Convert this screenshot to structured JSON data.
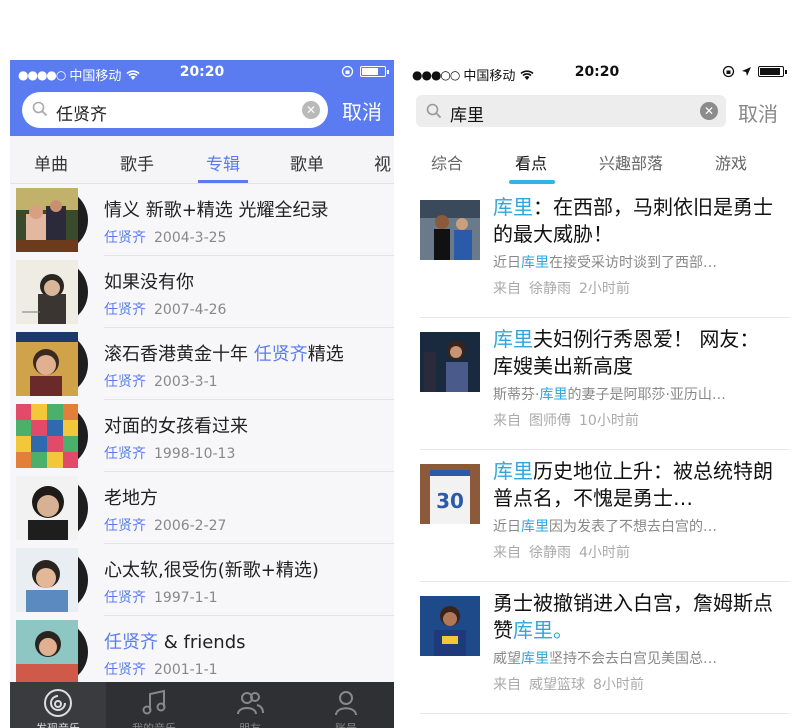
{
  "left": {
    "status": {
      "carrier": "中国移动",
      "time": "20:20"
    },
    "search": {
      "query": "任贤齐",
      "cancel": "取消"
    },
    "tabs": [
      "单曲",
      "歌手",
      "专辑",
      "歌单",
      "视"
    ],
    "active_tab": 2,
    "albums": [
      {
        "title": "情义 新歌+精选 光耀全纪录",
        "title_hl": "",
        "title_after": "",
        "artist": "任贤齐",
        "date": "2004-3-25"
      },
      {
        "title": "如果没有你",
        "title_hl": "",
        "title_after": "",
        "artist": "任贤齐",
        "date": "2007-4-26"
      },
      {
        "title": "滚石香港黄金十年 ",
        "title_hl": "任贤齐",
        "title_after": "精选",
        "artist": "任贤齐",
        "date": "2003-3-1"
      },
      {
        "title": "对面的女孩看过来",
        "title_hl": "",
        "title_after": "",
        "artist": "任贤齐",
        "date": "1998-10-13"
      },
      {
        "title": "老地方",
        "title_hl": "",
        "title_after": "",
        "artist": "任贤齐",
        "date": "2006-2-27"
      },
      {
        "title": "心太软,很受伤(新歌+精选)",
        "title_hl": "",
        "title_after": "",
        "artist": "任贤齐",
        "date": "1997-1-1"
      },
      {
        "title": "",
        "title_hl": "任贤齐",
        "title_after": " & friends",
        "artist": "任贤齐",
        "date": "2001-1-1"
      }
    ],
    "bottom_nav": [
      "发现音乐",
      "我的音乐",
      "朋友",
      "账号"
    ],
    "colors": {
      "accent": "#5b7cf0",
      "bottom_bar": "#2f3033"
    }
  },
  "right": {
    "status": {
      "carrier": "中国移动",
      "time": "20:20"
    },
    "search": {
      "query": "库里",
      "cancel": "取消"
    },
    "tabs": [
      "综合",
      "看点",
      "兴趣部落",
      "游戏"
    ],
    "active_tab": 1,
    "news": [
      {
        "headline_hl": "库里",
        "headline": "：在西部，马刺依旧是勇士的最大威胁！",
        "headline_after": "",
        "snippet_pre": "近日",
        "snippet_hl": "库里",
        "snippet_post": "在接受采访时谈到了西部…",
        "source_prefix": "来自",
        "source": "徐静雨",
        "time": "2小时前"
      },
      {
        "headline_hl": "库里",
        "headline": "夫妇例行秀恩爱！ 网友：库嫂美出新高度",
        "headline_after": "",
        "snippet_pre": "斯蒂芬·",
        "snippet_hl": "库里",
        "snippet_post": "的妻子是阿耶莎·亚历山…",
        "source_prefix": "来自",
        "source": "图师傅",
        "time": "10小时前"
      },
      {
        "headline_hl": "库里",
        "headline": "历史地位上升：被总统特朗普点名，不愧是勇士…",
        "headline_after": "",
        "snippet_pre": "近日",
        "snippet_hl": "库里",
        "snippet_post": "因为发表了不想去白宫的…",
        "source_prefix": "来自",
        "source": "徐静雨",
        "time": "4小时前"
      },
      {
        "headline_hl": "",
        "headline": "勇士被撤销进入白宫，詹姆斯点赞",
        "headline_after": "库里。",
        "snippet_pre": "威望",
        "snippet_hl": "库里",
        "snippet_post": "坚持不会去白宫见美国总…",
        "source_prefix": "来自",
        "source": "威望篮球",
        "time": "8小时前"
      }
    ],
    "colors": {
      "accent": "#2fb6e6",
      "highlight": "#2fa6dd"
    }
  }
}
